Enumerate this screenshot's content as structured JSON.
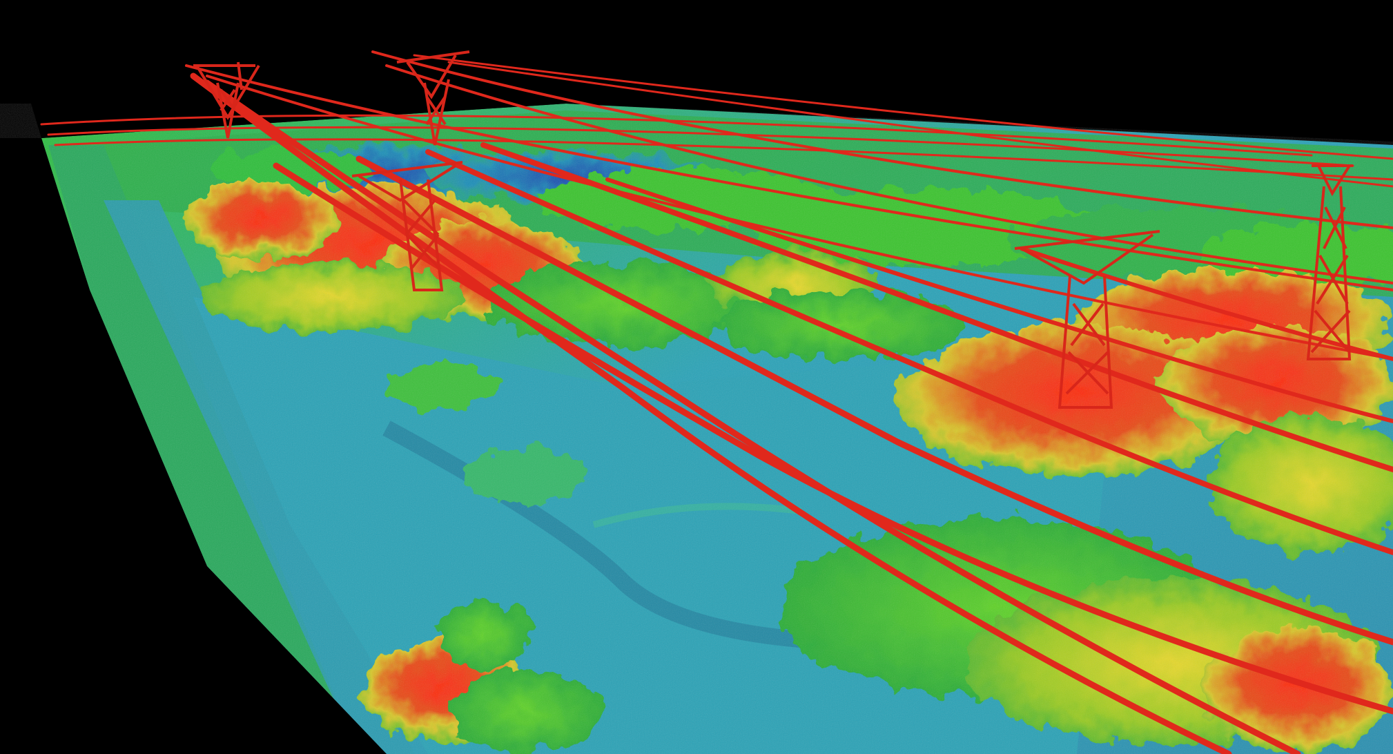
{
  "scene": {
    "background": "#000000",
    "palette": {
      "low": "#1f5fa8",
      "low_mid": "#2aa3b8",
      "mid": "#2fbf3a",
      "high_mid": "#d8d02a",
      "high": "#e03a1a",
      "wire": "#e0281c"
    },
    "pylon_count": 5,
    "wire_bundle_count": 3
  }
}
